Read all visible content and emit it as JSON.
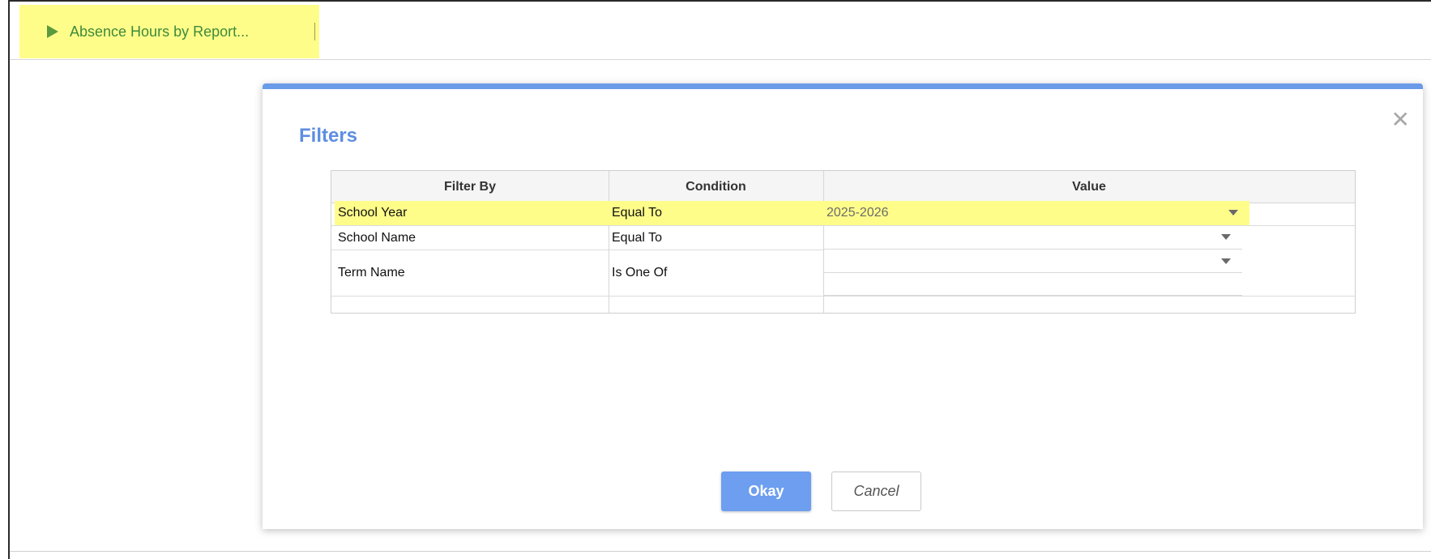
{
  "tab": {
    "icon": "play-icon",
    "label": "Absence Hours by Report..."
  },
  "dialog": {
    "title": "Filters",
    "close_icon": "close-icon",
    "columns": [
      "Filter By",
      "Condition",
      "Value"
    ],
    "rows": [
      {
        "filter_by": "School Year",
        "condition": "Equal To",
        "value": "2025-2026"
      },
      {
        "filter_by": "School Name",
        "condition": "Equal To",
        "value": ""
      },
      {
        "filter_by": "Term Name",
        "condition": "Is One Of",
        "value": ""
      }
    ],
    "okay_label": "Okay",
    "cancel_label": "Cancel"
  },
  "colors": {
    "highlight": "#fffd8a",
    "accent": "#6a9be8",
    "tab_text": "#3e8a3b"
  }
}
